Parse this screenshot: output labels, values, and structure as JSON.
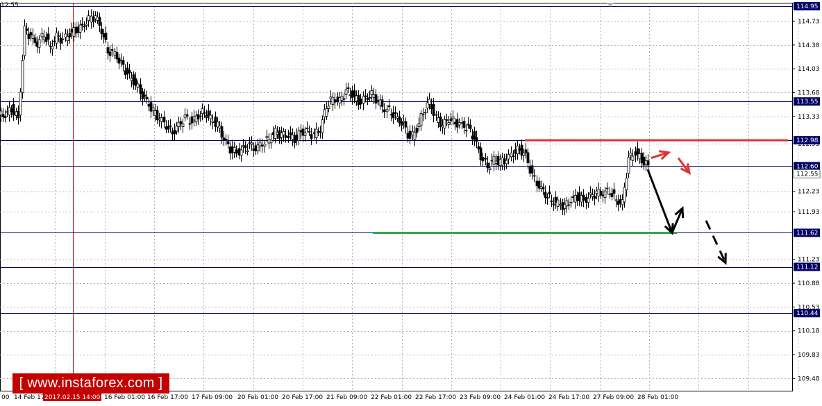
{
  "chart_data": {
    "type": "candlestick",
    "instrument_label": "12.55",
    "y_axis": {
      "ylim": [
        109.3,
        115.0
      ],
      "ticks": [
        "114.73",
        "114.38",
        "114.03",
        "113.68",
        "113.33",
        "112.93",
        "112.23",
        "111.93",
        "111.23",
        "110.88",
        "110.53",
        "110.18",
        "109.83",
        "109.48"
      ]
    },
    "x_axis": {
      "tick_labels": [
        "00",
        "14 Feb 17:00",
        "2017.02.15 14:00",
        "16 Feb 01:00",
        "16 Feb 17:00",
        "17 Feb 09:00",
        "20 Feb 01:00",
        "20 Feb 17:00",
        "21 Feb 09:00",
        "22 Feb 01:00",
        "22 Feb 17:00",
        "23 Feb 09:00",
        "24 Feb 01:00",
        "24 Feb 17:00",
        "27 Feb 09:00",
        "28 Feb 01:00"
      ],
      "highlighted_label": "2017.02.15 14:00"
    },
    "levels": [
      {
        "value": 114.95,
        "label": "114.95"
      },
      {
        "value": 113.55,
        "label": "113.55"
      },
      {
        "value": 112.98,
        "label": "112.98"
      },
      {
        "value": 112.6,
        "label": "112.60"
      },
      {
        "value": 111.62,
        "label": "111.62"
      },
      {
        "value": 111.12,
        "label": "111.12"
      },
      {
        "value": 110.44,
        "label": "110.44"
      }
    ],
    "current_price_marker": {
      "value": 112.55,
      "label": "112.55"
    },
    "resistance_line": {
      "value": 112.98,
      "color": "#e03030"
    },
    "support_line": {
      "value": 111.62,
      "color": "#2ea84a"
    },
    "closes": [
      113.35,
      113.45,
      113.3,
      114.6,
      114.5,
      114.4,
      114.55,
      114.35,
      114.5,
      114.45,
      114.55,
      114.6,
      114.65,
      114.75,
      114.8,
      114.6,
      114.3,
      114.25,
      114.1,
      113.95,
      113.85,
      113.7,
      113.55,
      113.4,
      113.3,
      113.2,
      113.1,
      113.2,
      113.3,
      113.25,
      113.35,
      113.4,
      113.3,
      113.2,
      113.0,
      112.85,
      112.8,
      112.85,
      112.9,
      112.85,
      112.95,
      113.0,
      113.1,
      113.05,
      113.05,
      113.0,
      113.1,
      113.1,
      113.05,
      113.15,
      113.5,
      113.6,
      113.55,
      113.7,
      113.65,
      113.55,
      113.6,
      113.65,
      113.55,
      113.45,
      113.4,
      113.3,
      113.2,
      113.0,
      113.15,
      113.4,
      113.55,
      113.3,
      113.2,
      113.3,
      113.25,
      113.2,
      113.15,
      113.0,
      112.75,
      112.6,
      112.7,
      112.65,
      112.7,
      112.8,
      112.85,
      112.75,
      112.45,
      112.3,
      112.2,
      112.1,
      112.05,
      112.0,
      112.1,
      112.15,
      112.1,
      112.15,
      112.2,
      112.2,
      112.25,
      112.1,
      112.05,
      112.7,
      112.8,
      112.7,
      112.6
    ],
    "arrows": {
      "black_down": {
        "from": 112.55,
        "to": 111.62
      },
      "black_up": {
        "from": 111.62,
        "to": 111.98
      },
      "black_dashed_down": {
        "from": 111.8,
        "to": 111.18
      },
      "red_dashed_down": {
        "from": 112.8,
        "to": 112.5
      }
    },
    "grid": true,
    "colors": {
      "candles": "#000000",
      "levels": "#000066",
      "vertical_marker": "#cc0000",
      "highlight_badge": "#c40000"
    }
  },
  "watermark": {
    "text": "[ www.instaforex.com ]"
  }
}
